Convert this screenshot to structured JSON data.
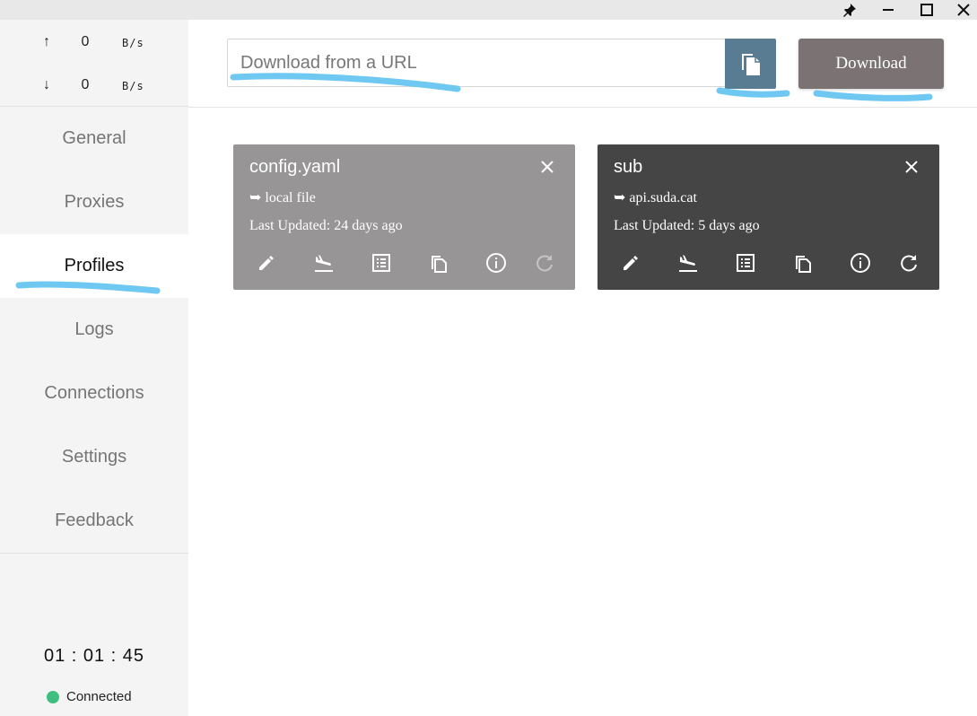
{
  "window": {
    "controls": [
      "pin-icon",
      "minimize-icon",
      "maximize-icon",
      "close-icon"
    ]
  },
  "traffic": {
    "up": {
      "arrow": "↑",
      "value": "0",
      "unit": "B/s"
    },
    "down": {
      "arrow": "↓",
      "value": "0",
      "unit": "B/s"
    }
  },
  "nav": {
    "items": [
      {
        "label": "General"
      },
      {
        "label": "Proxies"
      },
      {
        "label": "Profiles"
      },
      {
        "label": "Logs"
      },
      {
        "label": "Connections"
      },
      {
        "label": "Settings"
      },
      {
        "label": "Feedback"
      }
    ],
    "active": "Profiles"
  },
  "status": {
    "clock": "01 : 01 : 45",
    "connection": "Connected",
    "connection_color": "#3fbf7f"
  },
  "header": {
    "url_placeholder": "Download from a URL",
    "paste_icon": "paste-icon",
    "download_label": "Download"
  },
  "profiles": [
    {
      "name": "config.yaml",
      "source": "➥ local file",
      "updated": "Last Updated: 24 days ago",
      "selected": false,
      "bg": "#979595"
    },
    {
      "name": "sub",
      "source": "➥ api.suda.cat",
      "updated": "Last Updated: 5 days ago",
      "selected": true,
      "bg": "#464545"
    }
  ],
  "colors": {
    "accent_blue": "#5a7c92",
    "download_btn": "#7b7373",
    "highlight": "#6fc8f2"
  }
}
